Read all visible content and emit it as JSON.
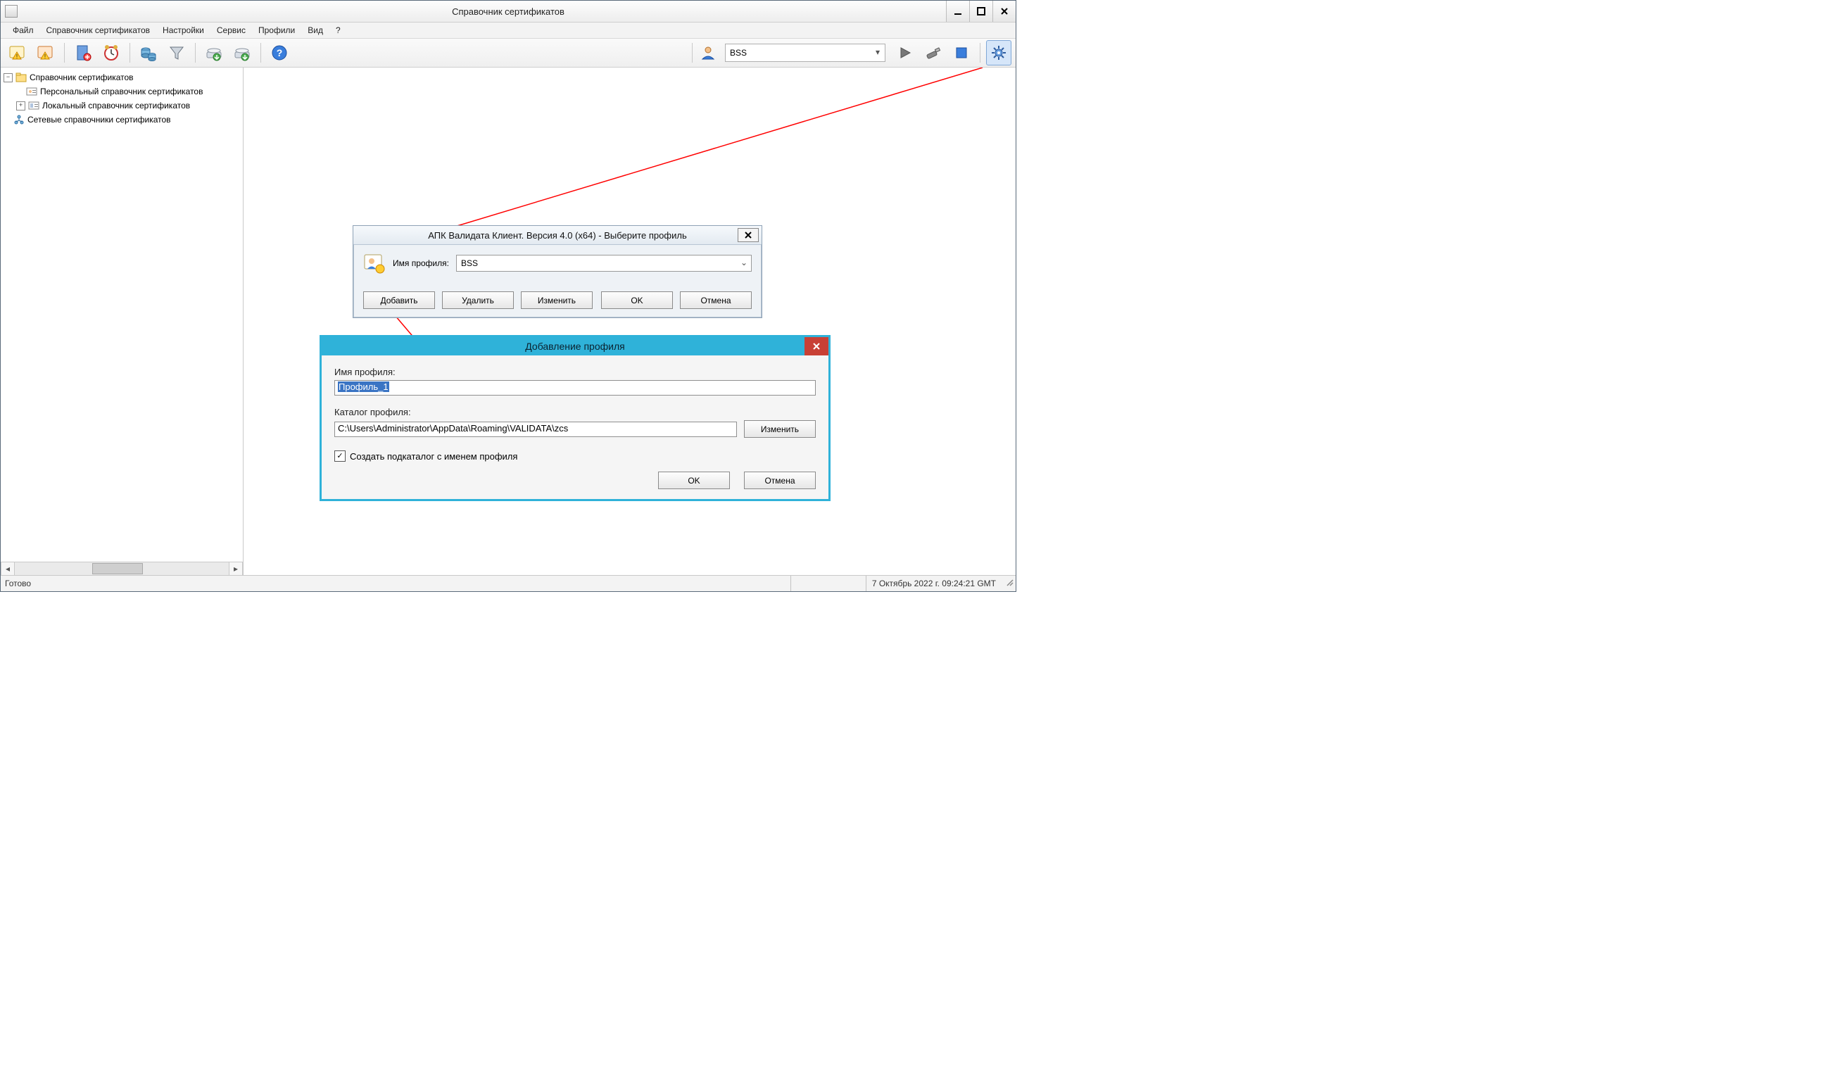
{
  "title": "Справочник сертификатов",
  "menu": {
    "file": "Файл",
    "cert_ref": "Справочник сертификатов",
    "settings": "Настройки",
    "service": "Сервис",
    "profiles": "Профили",
    "view": "Вид",
    "help": "?"
  },
  "toolbar": {
    "profile_value": "BSS"
  },
  "tree": {
    "root": "Справочник сертификатов",
    "personal": "Персональный справочник сертификатов",
    "local": "Локальный справочник сертификатов",
    "network": "Сетевые справочники сертификатов"
  },
  "dlg1": {
    "title": "АПК Валидата Клиент. Версия 4.0 (x64) - Выберите профиль",
    "name_label": "Имя профиля:",
    "name_value": "BSS",
    "btn_add": "Добавить",
    "btn_delete": "Удалить",
    "btn_change": "Изменить",
    "btn_ok": "OK",
    "btn_cancel": "Отмена"
  },
  "dlg2": {
    "title": "Добавление профиля",
    "name_label": "Имя профиля:",
    "name_value": "Профиль_1",
    "catalog_label": "Каталог профиля:",
    "catalog_value": "C:\\Users\\Administrator\\AppData\\Roaming\\VALIDATA\\zcs",
    "btn_change": "Изменить",
    "cb_label": "Создать подкаталог с именем профиля",
    "cb_checked": true,
    "btn_ok": "OK",
    "btn_cancel": "Отмена"
  },
  "status": {
    "ready": "Готово",
    "datetime": "7 Октябрь 2022 г. 09:24:21 GMT"
  }
}
